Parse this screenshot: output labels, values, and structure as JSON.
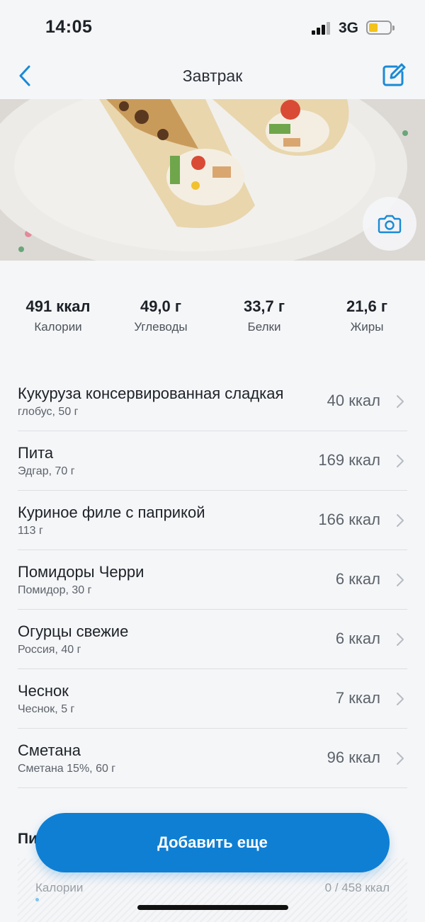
{
  "status_bar": {
    "time": "14:05",
    "network": "3G",
    "battery_color": "#f2c31b"
  },
  "nav": {
    "title": "Завтрак",
    "back_icon": "chevron-left-icon",
    "edit_icon": "edit-icon",
    "accent": "#1a8ad6"
  },
  "photo": {
    "camera_icon": "camera-icon"
  },
  "macros": [
    {
      "value": "491 ккал",
      "label": "Калории"
    },
    {
      "value": "49,0 г",
      "label": "Углеводы"
    },
    {
      "value": "33,7 г",
      "label": "Белки"
    },
    {
      "value": "21,6 г",
      "label": "Жиры"
    }
  ],
  "foods": [
    {
      "name": "Кукуруза консервированная сладкая",
      "sub": "глобус, 50 г",
      "kcal": "40 ккал"
    },
    {
      "name": "Пита",
      "sub": "Эдгар, 70 г",
      "kcal": "169 ккал"
    },
    {
      "name": "Куриное филе с паприкой",
      "sub": "113 г",
      "kcal": "166 ккал"
    },
    {
      "name": "Помидоры Черри",
      "sub": "Помидор, 30 г",
      "kcal": "6 ккал"
    },
    {
      "name": "Огурцы свежие",
      "sub": "Россия, 40 г",
      "kcal": "6 ккал"
    },
    {
      "name": "Чеснок",
      "sub": "Чеснок, 5 г",
      "kcal": "7 ккал"
    },
    {
      "name": "Сметана",
      "sub": "Сметана 15%, 60 г",
      "kcal": "96 ккал"
    }
  ],
  "bottom_section": {
    "title_partial": "Пи",
    "calories_label": "Калории",
    "calories_value": "0 / 458 ккал"
  },
  "add_button": {
    "label": "Добавить еще",
    "color": "#0f7fd3"
  }
}
